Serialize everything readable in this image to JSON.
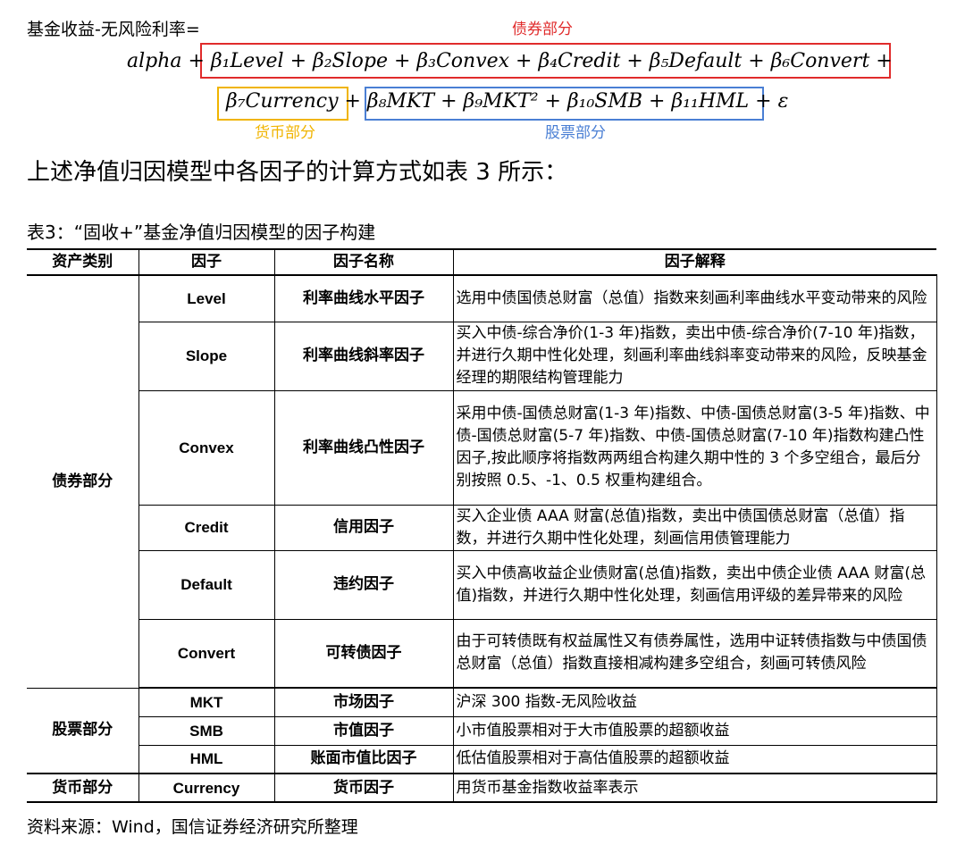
{
  "header": {
    "label": "基金收益-无风险利率=",
    "bond_tag": "债券部分",
    "currency_tag": "货币部分",
    "stock_tag": "股票部分"
  },
  "formula": {
    "line1": "alpha + β₁Level + β₂Slope + β₃Convex + β₄Credit + β₅Default + β₆Convert +",
    "line2": "β₇Currency + β₈MKT + β₉MKT² + β₁₀SMB + β₁₁HML + ε"
  },
  "paragraph": "上述净值归因模型中各因子的计算方式如表 3 所示：",
  "table_caption": "表3：“固收+”基金净值归因模型的因子构建",
  "table": {
    "headers": [
      "资产类别",
      "因子",
      "因子名称",
      "因子解释"
    ],
    "rows": [
      {
        "category": "债券部分",
        "factor": "Level",
        "name": "利率曲线水平因子",
        "explain": "选用中债国债总财富（总值）指数来刻画利率曲线水平变动带来的风险"
      },
      {
        "category": "",
        "factor": "Slope",
        "name": "利率曲线斜率因子",
        "explain": "买入中债-综合净价(1-3 年)指数，卖出中债-综合净价(7-10 年)指数，并进行久期中性化处理，刻画利率曲线斜率变动带来的风险，反映基金经理的期限结构管理能力"
      },
      {
        "category": "",
        "factor": "Convex",
        "name": "利率曲线凸性因子",
        "explain": "采用中债-国债总财富(1-3 年)指数、中债-国债总财富(3-5 年)指数、中债-国债总财富(5-7 年)指数、中债-国债总财富(7-10 年)指数构建凸性因子,按此顺序将指数两两组合构建久期中性的 3 个多空组合，最后分别按照 0.5、-1、0.5 权重构建组合。"
      },
      {
        "category": "",
        "factor": "Credit",
        "name": "信用因子",
        "explain": "买入企业债 AAA 财富(总值)指数，卖出中债国债总财富（总值）指数，并进行久期中性化处理，刻画信用债管理能力"
      },
      {
        "category": "",
        "factor": "Default",
        "name": "违约因子",
        "explain": "买入中债高收益企业债财富(总值)指数，卖出中债企业债 AAA 财富(总值)指数，并进行久期中性化处理，刻画信用评级的差异带来的风险"
      },
      {
        "category": "",
        "factor": "Convert",
        "name": "可转债因子",
        "explain": "由于可转债既有权益属性又有债券属性，选用中证转债指数与中债国债总财富（总值）指数直接相减构建多空组合，刻画可转债风险"
      },
      {
        "category": "股票部分",
        "factor": "MKT",
        "name": "市场因子",
        "explain": "沪深 300 指数-无风险收益"
      },
      {
        "category": "",
        "factor": "SMB",
        "name": "市值因子",
        "explain": "小市值股票相对于大市值股票的超额收益"
      },
      {
        "category": "",
        "factor": "HML",
        "name": "账面市值比因子",
        "explain": "低估值股票相对于高估值股票的超额收益"
      },
      {
        "category": "货币部分",
        "factor": "Currency",
        "name": "货币因子",
        "explain": "用货币基金指数收益率表示"
      }
    ]
  },
  "source": "资料来源：Wind，国信证券经济研究所整理",
  "colors": {
    "bond": "#e02b2b",
    "currency": "#f0b400",
    "stock": "#4a7fd4"
  }
}
